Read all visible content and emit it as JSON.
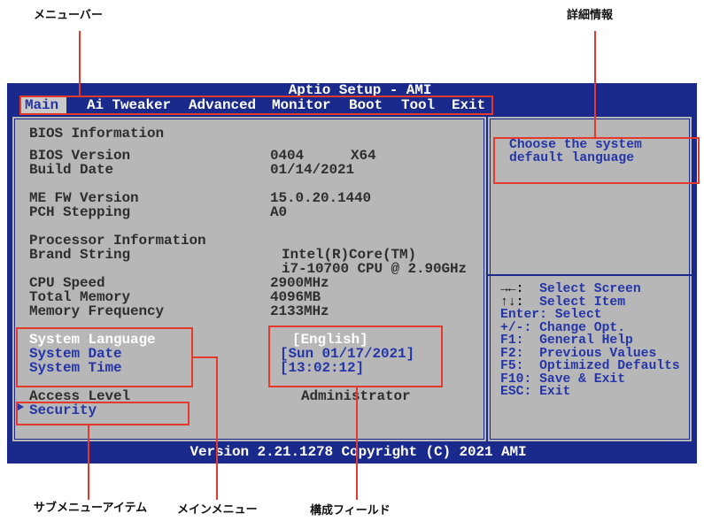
{
  "annotations": {
    "menu_bar": "メニューバー",
    "item_details": "詳細情報",
    "submenu_item": "サブメニューアイテム",
    "main_menu": "メインメニュー",
    "config_fields": "構成フィールド"
  },
  "bios": {
    "title": "Aptio Setup - AMI",
    "menu": [
      {
        "label": "Main",
        "active": true
      },
      {
        "label": "Ai Tweaker"
      },
      {
        "label": "Advanced"
      },
      {
        "label": "Monitor"
      },
      {
        "label": "Boot"
      },
      {
        "label": "Tool"
      },
      {
        "label": "Exit"
      }
    ],
    "info": {
      "bios_section": "BIOS Information",
      "bios_version": {
        "label": "BIOS Version",
        "value": "0404",
        "arch": "X64"
      },
      "build_date": {
        "label": "Build Date",
        "value": "01/14/2021"
      },
      "me_fw_version": {
        "label": "ME FW Version",
        "value": "15.0.20.1440"
      },
      "pch_stepping": {
        "label": "PCH Stepping",
        "value": "A0"
      },
      "processor_section": "Processor Information",
      "brand_string": {
        "label": "Brand String",
        "value": [
          "Intel(R)Core(TM)",
          "i7-10700 CPU @ 2.90GHz"
        ]
      },
      "cpu_speed": {
        "label": "CPU Speed",
        "value": "2900MHz"
      },
      "total_memory": {
        "label": "Total Memory",
        "value": "4096MB"
      },
      "memory_frequency": {
        "label": "Memory Frequency",
        "value": "2133MHz"
      }
    },
    "settings": {
      "system_language": {
        "label": "System Language",
        "value": "[English]",
        "selected": true
      },
      "system_date": {
        "label": "System Date",
        "value": "[Sun 01/17/2021]"
      },
      "system_time": {
        "label": "System Time",
        "value": "[13:02:12]"
      },
      "access_level": {
        "label": "Access Level",
        "value": "Administrator"
      },
      "security": {
        "label": "Security",
        "icon": "submenu-arrow-icon"
      }
    },
    "help_text": [
      "Choose the system",
      "default language"
    ],
    "keys": [
      {
        "key": "→←:",
        "desc": "Select Screen"
      },
      {
        "key": "↑↓:",
        "desc": "Select Item"
      },
      {
        "key": "Enter:",
        "desc": "Select"
      },
      {
        "key": "+/-:",
        "desc": "Change Opt."
      },
      {
        "key": "F1:",
        "desc": "General Help"
      },
      {
        "key": "F2:",
        "desc": "Previous Values"
      },
      {
        "key": "F5:",
        "desc": "Optimized Defaults"
      },
      {
        "key": "F10:",
        "desc": "Save & Exit"
      },
      {
        "key": "ESC:",
        "desc": "Exit"
      }
    ],
    "footer": "Version 2.21.1278 Copyright (C) 2021 AMI"
  },
  "colors": {
    "screen_blue": "#1a2a8c",
    "panel_gray": "#b7b7b7",
    "highlight_blue": "#2435a8",
    "annotation_red": "#e5392b"
  }
}
